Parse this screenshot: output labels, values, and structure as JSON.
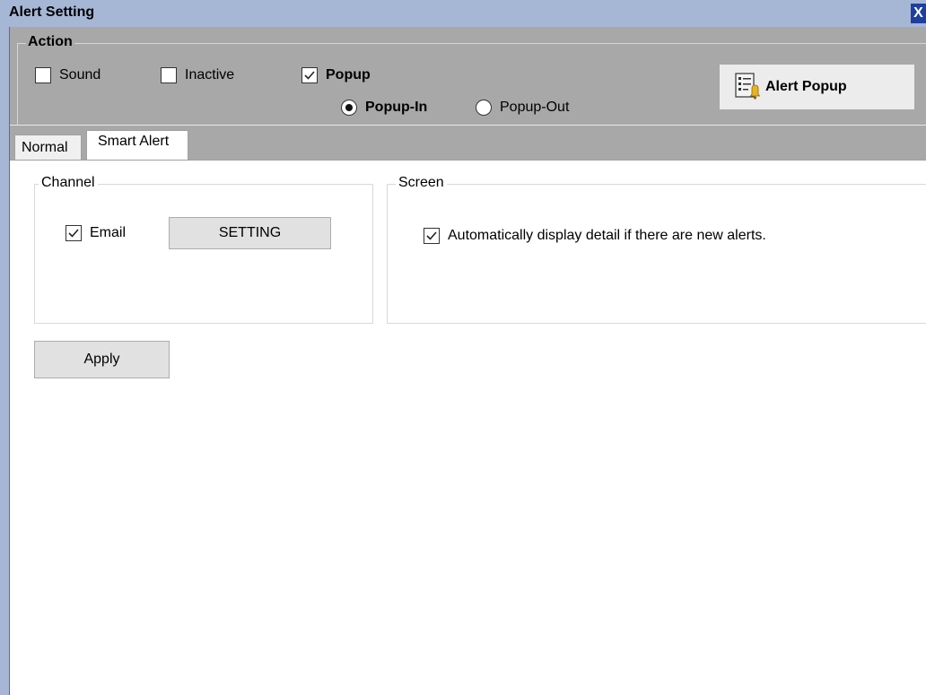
{
  "window": {
    "title": "Alert Setting",
    "close_label": "X"
  },
  "action": {
    "legend": "Action",
    "sound": {
      "label": "Sound",
      "checked": false
    },
    "inactive": {
      "label": "Inactive",
      "checked": false
    },
    "popup": {
      "label": "Popup",
      "checked": true
    },
    "popup_in": {
      "label": "Popup-In",
      "selected": true
    },
    "popup_out": {
      "label": "Popup-Out",
      "selected": false
    },
    "alert_popup_button": {
      "label": "Alert Popup",
      "icon": "alert-list-bell-icon"
    }
  },
  "tabs": [
    {
      "label": "Normal",
      "active": false
    },
    {
      "label": "Smart Alert",
      "active": true
    }
  ],
  "channel": {
    "legend": "Channel",
    "email": {
      "label": "Email",
      "checked": true
    },
    "setting_button": "SETTING"
  },
  "screen": {
    "legend": "Screen",
    "auto_display": {
      "label": "Automatically display detail if there are new alerts.",
      "checked": true
    }
  },
  "apply_button": "Apply"
}
